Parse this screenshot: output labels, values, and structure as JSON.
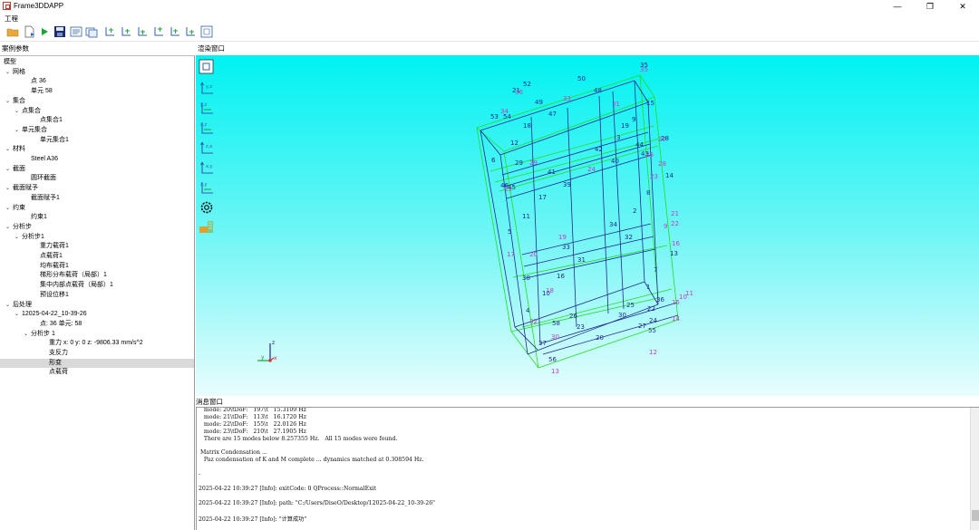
{
  "window": {
    "title": "Frame3DDAPP"
  },
  "menu": {
    "project": "工程"
  },
  "toolbar": {
    "buttons": [
      "open-folder-icon",
      "new-file-icon",
      "run-icon",
      "save-icon",
      "view-list-icon",
      "view-window-icon",
      "view-xy-icon",
      "view-xz-icon",
      "view-yz-icon",
      "view-zx-icon",
      "view-zy-icon",
      "view-yx-icon",
      "fit-view-icon"
    ]
  },
  "panels": {
    "left_title": "案例参数",
    "viewport_title": "渲染窗口",
    "console_title": "消息窗口"
  },
  "tree": [
    {
      "text": "模型",
      "arrow": "",
      "indent": 0
    },
    {
      "text": "网格",
      "arrow": "v",
      "indent": 1
    },
    {
      "text": "点 36",
      "arrow": "",
      "indent": 3
    },
    {
      "text": "单元 58",
      "arrow": "",
      "indent": 3
    },
    {
      "text": "集合",
      "arrow": "v",
      "indent": 1
    },
    {
      "text": "点集合",
      "arrow": "v",
      "indent": 2
    },
    {
      "text": "点集合1",
      "arrow": "",
      "indent": 4
    },
    {
      "text": "单元集合",
      "arrow": "v",
      "indent": 2
    },
    {
      "text": "单元集合1",
      "arrow": "",
      "indent": 4
    },
    {
      "text": "材料",
      "arrow": "v",
      "indent": 1
    },
    {
      "text": "Steel A36",
      "arrow": "",
      "indent": 3
    },
    {
      "text": "截面",
      "arrow": "v",
      "indent": 1
    },
    {
      "text": "圆环截面",
      "arrow": "",
      "indent": 3
    },
    {
      "text": "截面赋予",
      "arrow": "v",
      "indent": 1
    },
    {
      "text": "截面赋予1",
      "arrow": "",
      "indent": 3
    },
    {
      "text": "约束",
      "arrow": "v",
      "indent": 1
    },
    {
      "text": "约束1",
      "arrow": "",
      "indent": 3
    },
    {
      "text": "分析步",
      "arrow": "v",
      "indent": 1
    },
    {
      "text": "分析步1",
      "arrow": "v",
      "indent": 2
    },
    {
      "text": "重力载荷1",
      "arrow": "",
      "indent": 4
    },
    {
      "text": "点载荷1",
      "arrow": "",
      "indent": 4
    },
    {
      "text": "均布载荷1",
      "arrow": "",
      "indent": 4
    },
    {
      "text": "梯形分布载荷（局部）1",
      "arrow": "",
      "indent": 4
    },
    {
      "text": "集中内部点载荷（局部）1",
      "arrow": "",
      "indent": 4
    },
    {
      "text": "预设位移1",
      "arrow": "",
      "indent": 4
    },
    {
      "text": "后处理",
      "arrow": "v",
      "indent": 1
    },
    {
      "text": "12025-04-22_10-39-26",
      "arrow": "v",
      "indent": 2
    },
    {
      "text": "点: 36 单元: 58",
      "arrow": "",
      "indent": 4
    },
    {
      "text": "分析步 1",
      "arrow": "v",
      "indent": 3
    },
    {
      "text": "重力 x: 0 y: 0 z: -9806.33 mm/s^2",
      "arrow": "",
      "indent": 5
    },
    {
      "text": "支反力",
      "arrow": "",
      "indent": 5
    },
    {
      "text": "形变",
      "arrow": "",
      "indent": 5,
      "selected": true
    },
    {
      "text": "点载荷",
      "arrow": "",
      "indent": 5
    }
  ],
  "viewport": {
    "tools": [
      "fit-view-icon",
      "view-yz-icon",
      "view-yx-icon",
      "view-xz-icon",
      "view-zx-icon",
      "view-xy-icon",
      "view-yx-alt-icon",
      "settings-icon",
      "legend-icon"
    ],
    "axes": {
      "x": "x",
      "y": "y",
      "z": "z"
    },
    "element_labels": [
      "50",
      "48",
      "15",
      "49",
      "47",
      "9",
      "3",
      "54",
      "53",
      "18",
      "12",
      "42",
      "40",
      "14",
      "6",
      "41",
      "39",
      "17",
      "8",
      "11",
      "2",
      "34",
      "5",
      "33",
      "31",
      "32",
      "13",
      "16",
      "7",
      "10",
      "4",
      "1",
      "25",
      "20",
      "30",
      "58",
      "23",
      "55",
      "56",
      "22",
      "27",
      "26",
      "37",
      "24",
      "43",
      "44",
      "45",
      "46",
      "29",
      "28",
      "35",
      "21",
      "36",
      "38",
      "19",
      "52"
    ],
    "node_labels": [
      "35",
      "36",
      "33",
      "34",
      "31",
      "27",
      "28",
      "29",
      "25",
      "26",
      "24",
      "23",
      "21",
      "22",
      "19",
      "20",
      "18",
      "17",
      "15",
      "14",
      "13",
      "12",
      "10",
      "9",
      "11",
      "32",
      "30",
      "16"
    ]
  },
  "console": {
    "lines": [
      "   mode: 20\\tDoF:   197\\t   15.3109 Hz",
      "   mode: 21\\tDoF:   113\\t   16.1720 Hz",
      "   mode: 22\\tDoF:   155\\t   22.0126 Hz",
      "   mode: 23\\tDoF:   210\\t   27.1905 Hz",
      "   There are 15 modes below 8.257355 Hz.   All 15 modes were found.",
      "",
      " Matrix Condensation ...",
      "   Paz condensation of K and M complete ... dynamics matched at 0.308594 Hz.",
      "",
      "-",
      "",
      "2025-04-22 10:39:27 [Info]: exitCode: 0 QProcess::NormalExit",
      "",
      "2025-04-22 10:39:27 [Info]: path: \"C:/Users/DiseO/Desktop/12025-04-22_10-39-26\"",
      "",
      "2025-04-22 10:39:27 [Info]: \"计算成功\""
    ]
  },
  "colors": {
    "model": "#1f2a8c",
    "deformed": "#22dd22",
    "node": "#c040c0",
    "viewport_top": "#00f2f2",
    "viewport_bottom": "#e8fdfd"
  }
}
